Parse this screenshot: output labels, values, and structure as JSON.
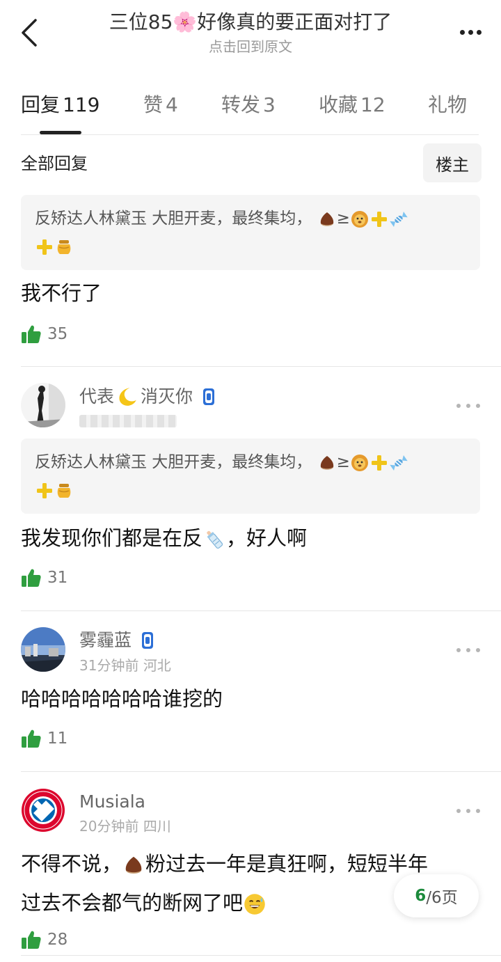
{
  "header": {
    "title": "三位85🌸好像真的要正面对打了",
    "subtitle": "点击回到原文"
  },
  "tabs": [
    {
      "label": "回复",
      "count": "119"
    },
    {
      "label": "赞",
      "count": "4"
    },
    {
      "label": "转发",
      "count": "3"
    },
    {
      "label": "收藏",
      "count": "12"
    },
    {
      "label": "礼物",
      "count": ""
    }
  ],
  "filter": {
    "all_label": "全部回复",
    "op_label": "楼主"
  },
  "replies": [
    {
      "quote": "反矫达人林黛玉 大胆开麦，最终集均，",
      "quote_tail": "≥",
      "text": "我不行了",
      "likes": "35"
    },
    {
      "user": "代表",
      "user_tail": "消灭你",
      "quote": "反矫达人林黛玉 大胆开麦，最终集均，",
      "quote_tail": "≥",
      "text": "我发现你们都是在反",
      "text_tail": "，好人啊",
      "likes": "31"
    },
    {
      "user": "雾霾蓝",
      "time": "31分钟前",
      "location": "河北",
      "text": "哈哈哈哈哈哈哈谁挖的",
      "likes": "11"
    },
    {
      "user": "Musiala",
      "time": "20分钟前",
      "location": "四川",
      "text_line1_a": "不得不说，",
      "text_line1_b": "粉过去一年是真狂啊，短短半年",
      "text_line2": "过去不会都气的断网了吧",
      "likes": "28"
    }
  ],
  "pagination": {
    "current": "6",
    "total": "/6页"
  },
  "colors": {
    "like_green": "#2f9e3f",
    "page_green": "#1c8a3c"
  }
}
